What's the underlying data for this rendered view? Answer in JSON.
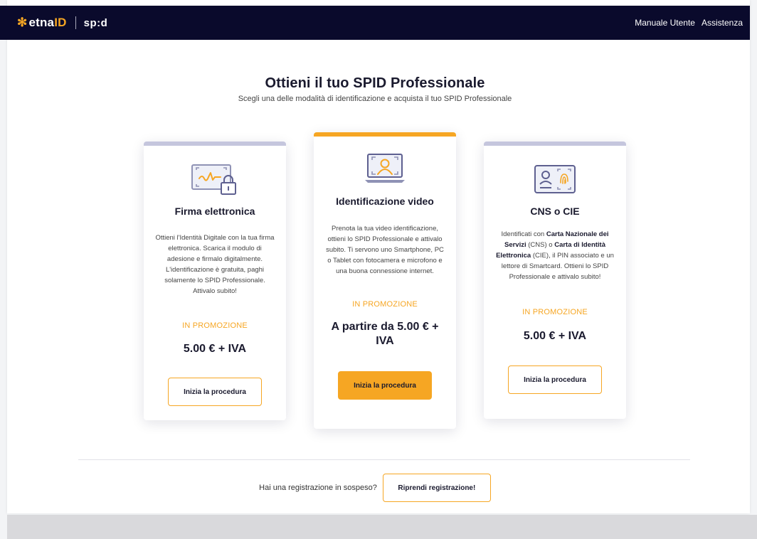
{
  "brand": {
    "etna_mark": "✻",
    "etna_prefix": "etna",
    "etna_suffix": "ID",
    "spid": "sp:d"
  },
  "nav": {
    "items": [
      "Manuale Utente",
      "Assistenza"
    ]
  },
  "heading": {
    "title": "Ottieni il tuo SPID Professionale",
    "subtitle": "Scegli una delle modalità di identificazione e acquista il tuo SPID Professionale"
  },
  "cards": [
    {
      "title": "Firma elettronica",
      "description": "Ottieni l'Identità Digitale con la tua firma elettronica. Scarica il modulo di adesione e firmalo digitalmente. L'identificazione è gratuita, paghi solamente lo SPID Professionale. Attivalo subito!",
      "promo": "IN PROMOZIONE",
      "price": "5.00 € + IVA",
      "button": "Inizia la procedura",
      "icon": "signature-lock-icon"
    },
    {
      "title": "Identificazione video",
      "description": "Prenota la tua video identificazione, ottieni lo SPID Professionale e attivalo subito. Ti servono uno Smartphone, PC o Tablet con fotocamera e microfono e una buona connessione internet.",
      "promo": "IN PROMOZIONE",
      "price": "A partire da 5.00 € + IVA",
      "button": "Inizia la procedura",
      "icon": "video-laptop-icon"
    },
    {
      "title": "CNS o CIE",
      "description_parts": [
        "Identificati con ",
        "Carta Nazionale dei Servizi",
        " (CNS) o ",
        "Carta di Identità Elettronica",
        " (CIE), il PIN associato e un lettore di Smartcard. Ottieni lo SPID Professionale e attivalo subito!"
      ],
      "promo": "IN PROMOZIONE",
      "price": "5.00 € + IVA",
      "button": "Inizia la procedura",
      "icon": "id-card-fingerprint-icon"
    }
  ],
  "pending": {
    "text": "Hai una registrazione in sospeso?",
    "button": "Riprendi registrazione!"
  },
  "colors": {
    "navy": "#0a0a2c",
    "accent": "#f6a623",
    "card_top_muted": "#c5c6dd"
  }
}
